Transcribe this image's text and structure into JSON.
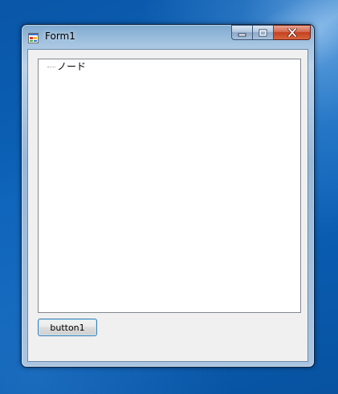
{
  "window": {
    "title": "Form1",
    "caption_buttons": [
      "minimize-icon",
      "maximize-icon",
      "close-icon"
    ]
  },
  "treeview": {
    "nodes": [
      {
        "label": "ノード"
      }
    ]
  },
  "button1": {
    "label": "button1"
  },
  "colors": {
    "desktop": "#0b62b8",
    "client_background": "#f0f0f0",
    "close_button": "#c4401f",
    "button_border": "#3c7fb1"
  }
}
